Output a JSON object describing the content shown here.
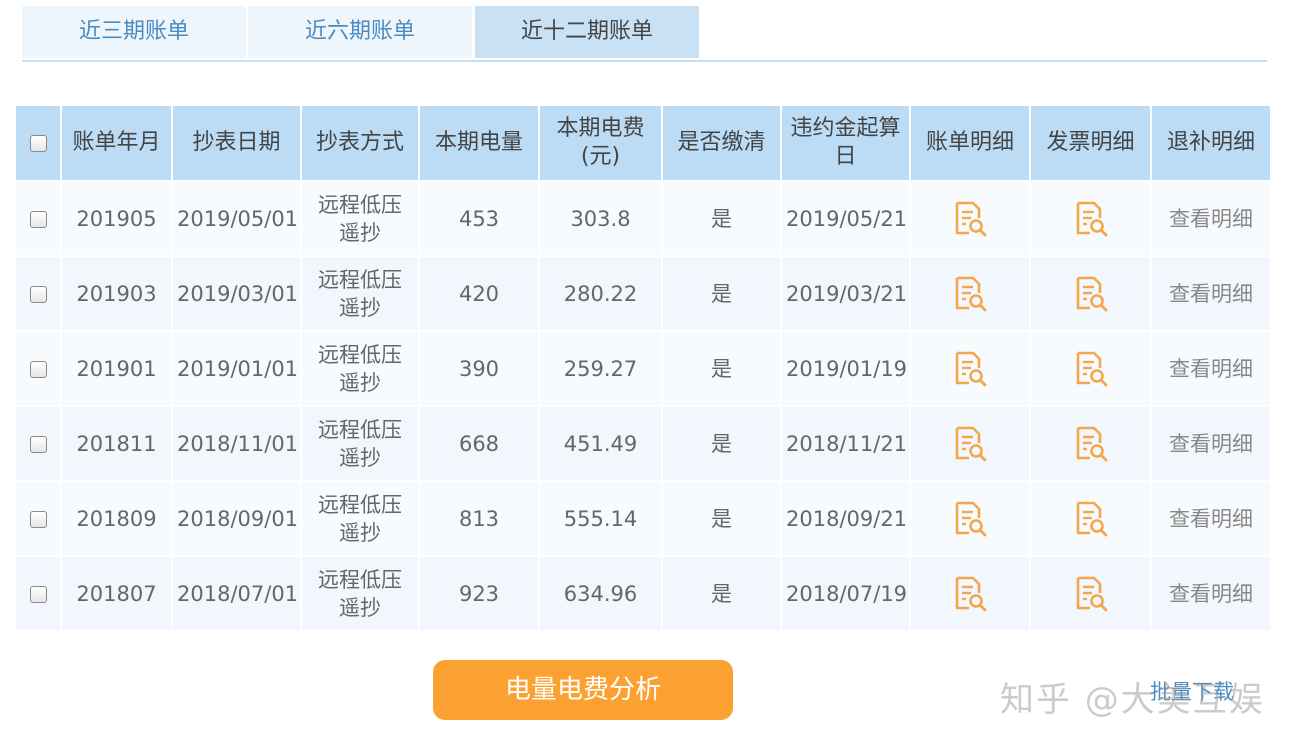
{
  "tabs": [
    {
      "label": "近三期账单",
      "active": false
    },
    {
      "label": "近六期账单",
      "active": false
    },
    {
      "label": "近十二期账单",
      "active": true
    }
  ],
  "table": {
    "headers": {
      "bill_month": "账单年月",
      "read_date": "抄表日期",
      "read_method": "抄表方式",
      "usage": "本期电量",
      "fee_line1": "本期电费",
      "fee_line2": "(元)",
      "paid": "是否缴清",
      "penalty_line1": "违约金起算",
      "penalty_line2": "日",
      "bill_detail": "账单明细",
      "invoice_detail": "发票明细",
      "refund_detail": "退补明细"
    },
    "rows": [
      {
        "month": "201905",
        "date": "2019/05/01",
        "method_line1": "远程低压",
        "method_line2": "遥抄",
        "usage": "453",
        "fee": "303.8",
        "paid": "是",
        "penalty_date": "2019/05/21",
        "refund_link": "查看明细"
      },
      {
        "month": "201903",
        "date": "2019/03/01",
        "method_line1": "远程低压",
        "method_line2": "遥抄",
        "usage": "420",
        "fee": "280.22",
        "paid": "是",
        "penalty_date": "2019/03/21",
        "refund_link": "查看明细"
      },
      {
        "month": "201901",
        "date": "2019/01/01",
        "method_line1": "远程低压",
        "method_line2": "遥抄",
        "usage": "390",
        "fee": "259.27",
        "paid": "是",
        "penalty_date": "2019/01/19",
        "refund_link": "查看明细"
      },
      {
        "month": "201811",
        "date": "2018/11/01",
        "method_line1": "远程低压",
        "method_line2": "遥抄",
        "usage": "668",
        "fee": "451.49",
        "paid": "是",
        "penalty_date": "2018/11/21",
        "refund_link": "查看明细"
      },
      {
        "month": "201809",
        "date": "2018/09/01",
        "method_line1": "远程低压",
        "method_line2": "遥抄",
        "usage": "813",
        "fee": "555.14",
        "paid": "是",
        "penalty_date": "2018/09/21",
        "refund_link": "查看明细"
      },
      {
        "month": "201807",
        "date": "2018/07/01",
        "method_line1": "远程低压",
        "method_line2": "遥抄",
        "usage": "923",
        "fee": "634.96",
        "paid": "是",
        "penalty_date": "2018/07/19",
        "refund_link": "查看明细"
      }
    ]
  },
  "actions": {
    "analysis_label": "电量电费分析",
    "batch_download_label": "批量下载"
  },
  "watermark": "知乎 @大美互娱",
  "icons": {
    "bill_detail": "document-search-icon",
    "invoice_detail": "document-search-icon"
  },
  "colors": {
    "accent": "#fba131",
    "header_bg": "#bcdcf5",
    "tab_text": "#4a8cc2",
    "icon": "#f5a64a"
  }
}
